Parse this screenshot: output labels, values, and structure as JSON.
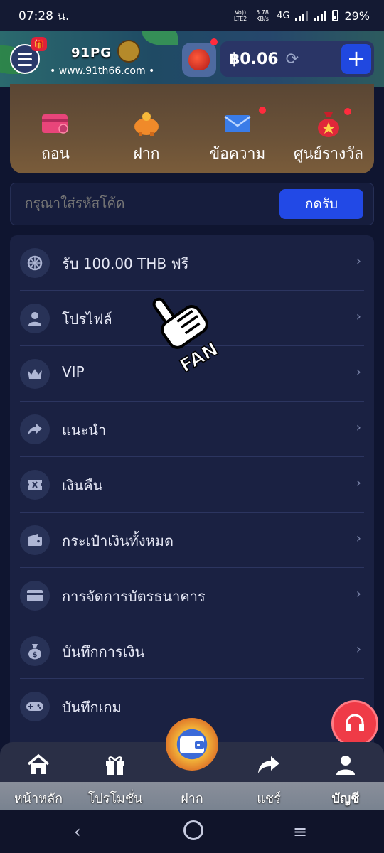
{
  "status_bar": {
    "time": "07:28 น.",
    "volte": "Vo)) LTE2",
    "speed": "5.78 KB/s",
    "network": "4G",
    "battery": "29%"
  },
  "header": {
    "logo_text": "91PG",
    "site_url": "www.91th66.com",
    "balance": "฿0.06"
  },
  "quick_actions": [
    {
      "label": "ถอน",
      "icon": "card-icon"
    },
    {
      "label": "ฝาก",
      "icon": "piggy-bank-icon"
    },
    {
      "label": "ข้อความ",
      "icon": "mail-icon"
    },
    {
      "label": "ศูนย์รางวัล",
      "icon": "prize-bag-icon"
    }
  ],
  "redeem": {
    "placeholder": "กรุณาใส่รหัสโค้ด",
    "button_label": "กดรับ"
  },
  "menu_items": [
    {
      "label": "รับ 100.00 THB ฟรี",
      "icon": "wheel-icon"
    },
    {
      "label": "โปรไฟล์",
      "icon": "user-icon"
    },
    {
      "label": "VIP",
      "icon": "crown-icon"
    },
    {
      "label": "แนะนำ",
      "icon": "share-icon"
    },
    {
      "label": "เงินคืน",
      "icon": "ticket-icon"
    },
    {
      "label": "กระเป๋าเงินทั้งหมด",
      "icon": "wallet-icon"
    },
    {
      "label": "การจัดการบัตรธนาคาร",
      "icon": "bank-card-icon"
    },
    {
      "label": "บันทึกการเงิน",
      "icon": "money-bag-icon"
    },
    {
      "label": "บันทึกเกม",
      "icon": "gamepad-icon"
    }
  ],
  "overlay": {
    "fan_text": "FAN"
  },
  "bottom_nav": [
    {
      "label": "หน้าหลัก",
      "icon": "home-icon"
    },
    {
      "label": "โปรโมชั่น",
      "icon": "gift-icon"
    },
    {
      "label": "ฝาก",
      "icon": "wallet-icon"
    },
    {
      "label": "แชร์",
      "icon": "share-icon"
    },
    {
      "label": "บัญชี",
      "icon": "profile-icon"
    }
  ],
  "colors": {
    "background": "#0f1530",
    "accent_blue": "#2249e6",
    "badge_red": "#ff2b3d",
    "card_gold": "#6b5238"
  }
}
